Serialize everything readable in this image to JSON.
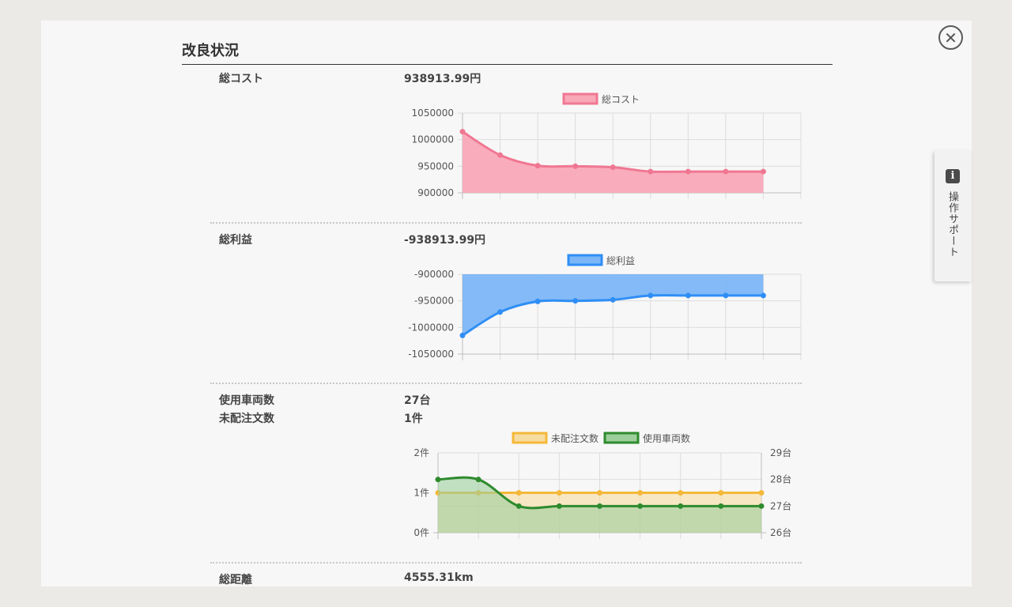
{
  "section_title": "改良状況",
  "close_icon": "close-icon",
  "side_tab": {
    "icon": "info-icon",
    "icon_glyph": "i",
    "label": "操作サポート"
  },
  "rows": {
    "cost": {
      "label": "総コスト",
      "value": "938913.99円"
    },
    "profit": {
      "label": "総利益",
      "value": "-938913.99円"
    },
    "vehicles": {
      "label": "使用車両数",
      "value": "27台"
    },
    "orders": {
      "label": "未配注文数",
      "value": "1件"
    },
    "distance": {
      "label": "総距離",
      "value": "4555.31km"
    }
  },
  "chart_data": [
    {
      "type": "area",
      "legend": "総コスト",
      "color": "#f07792",
      "fill": "#f9a8b8",
      "y_ticks": [
        "1050000",
        "1000000",
        "950000",
        "900000"
      ],
      "ylim": [
        900000,
        1050000
      ],
      "values": [
        1015000,
        971000,
        951000,
        950000,
        948000,
        940000,
        940000,
        940000,
        940000
      ]
    },
    {
      "type": "area",
      "legend": "総利益",
      "color": "#2f8ef5",
      "fill": "#7cb6f7",
      "y_ticks": [
        "-900000",
        "-950000",
        "-1000000",
        "-1050000"
      ],
      "ylim": [
        -1050000,
        -900000
      ],
      "values": [
        -1015000,
        -971000,
        -951000,
        -950000,
        -948000,
        -940000,
        -940000,
        -940000,
        -940000
      ]
    },
    {
      "type": "area",
      "series": [
        {
          "name": "未配注文数",
          "color": "#f5b83a",
          "fill": "#f6dca0",
          "axis": "left",
          "values": [
            1,
            1,
            1,
            1,
            1,
            1,
            1,
            1,
            1
          ]
        },
        {
          "name": "使用車両数",
          "color": "#2e8b2e",
          "fill": "#9ccf9c",
          "axis": "right",
          "values": [
            28,
            28,
            27,
            27,
            27,
            27,
            27,
            27,
            27
          ]
        }
      ],
      "left_ticks": [
        "2件",
        "1件",
        "0件"
      ],
      "left_lim": [
        0,
        2
      ],
      "right_ticks": [
        "29台",
        "28台",
        "27台",
        "26台"
      ],
      "right_lim": [
        26,
        29
      ]
    }
  ]
}
